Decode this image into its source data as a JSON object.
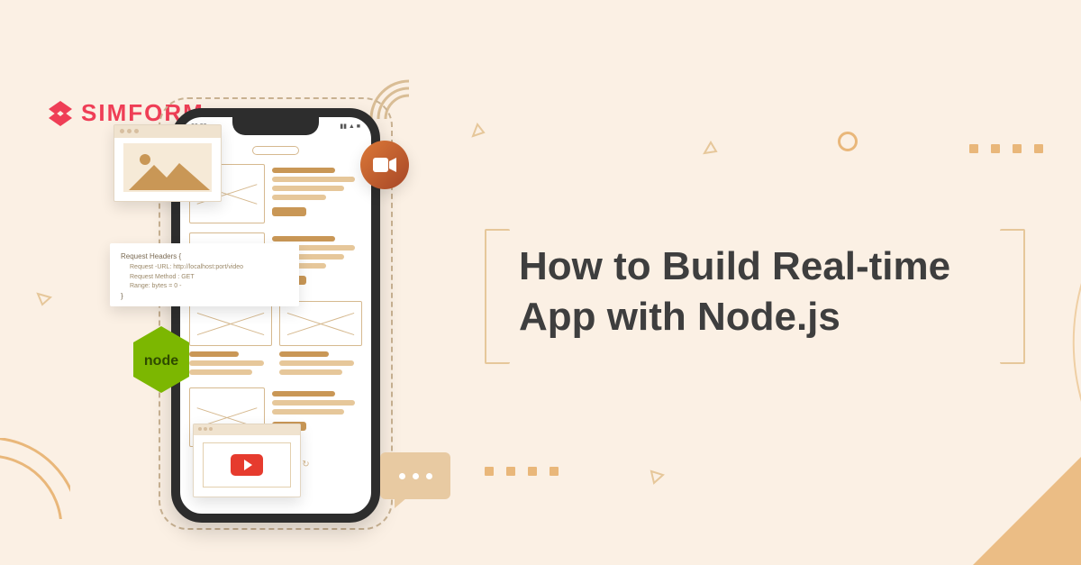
{
  "brand": {
    "name": "SIMFORM"
  },
  "headline": {
    "line1": "How to Build Real-time",
    "line2": "App with Node.js"
  },
  "node_badge": {
    "label": "node"
  },
  "code_card": {
    "header": "Request Headers    {",
    "l1": "Request -URL:  http://localhost:port/video",
    "l2": "Request   Method : GET",
    "l3": "Range:  bytes  = 0 -",
    "footer": "}"
  },
  "statusbar": {
    "time": "06:00"
  },
  "colors": {
    "bg": "#fbf0e4",
    "brand": "#ef3e56",
    "tan": "#e6c79a",
    "tan_dark": "#c99756",
    "node_green": "#7cb701",
    "video_grad_a": "#dc7938",
    "video_grad_b": "#a64627",
    "youtube_red": "#e63b2e",
    "text": "#3e3e3e"
  }
}
